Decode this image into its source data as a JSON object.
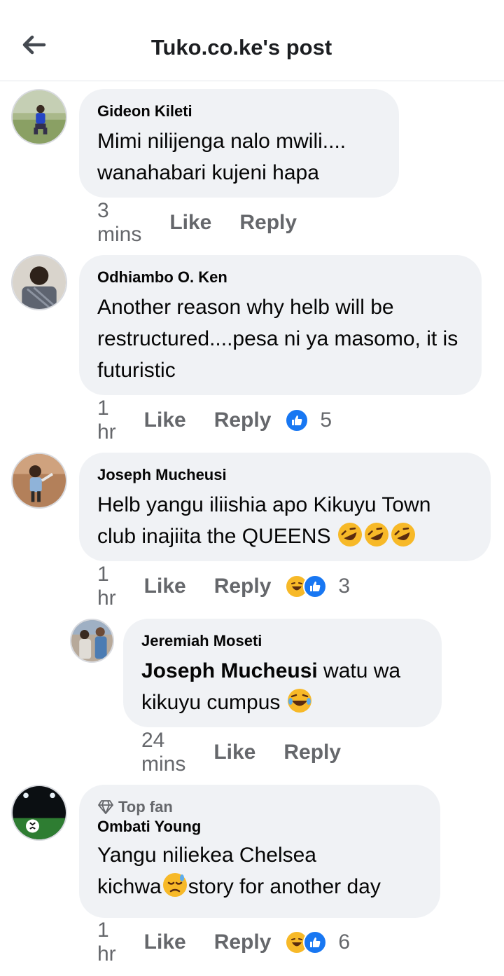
{
  "header": {
    "title": "Tuko.co.ke's post"
  },
  "comments": [
    {
      "author": "Gideon Kileti",
      "text": "Mimi nilijenga nalo mwili.... wanahabari kujeni hapa",
      "time": "3 mins",
      "like": "Like",
      "reply": "Reply"
    },
    {
      "author": "Odhiambo O. Ken",
      "text": "Another reason why helb will be restructured....pesa ni ya masomo, it is futuristic",
      "time": "1 hr",
      "like": "Like",
      "reply": "Reply",
      "reaction_count": "5"
    },
    {
      "author": "Joseph Mucheusi",
      "text_line1": "Helb yangu iliishia apo Kikuyu Town",
      "text_line2": "club inajiita the QUEENS",
      "time": "1 hr",
      "like": "Like",
      "reply": "Reply",
      "reaction_count": "3"
    },
    {
      "author": "Jeremiah Moseti",
      "mention": "Joseph Mucheusi",
      "text_line1": " watu wa",
      "text_line2": "kikuyu cumpus",
      "time": "24 mins",
      "like": "Like",
      "reply": "Reply"
    },
    {
      "badge": "Top fan",
      "author": "Ombati Young",
      "text_line1": "Yangu niliekea Chelsea",
      "text_line2a": "kichwa",
      "text_line2b": "story for another day",
      "time": "1 hr",
      "like": "Like",
      "reply": "Reply",
      "reaction_count": "6"
    }
  ],
  "icons": {
    "back": "arrow-left-icon",
    "like": "thumbs-up-icon",
    "haha": "laughing-emoji-icon",
    "rofl": "rolling-laughing-emoji-icon",
    "joy": "tears-of-joy-emoji-icon",
    "sad": "sad-sweat-emoji-icon",
    "diamond": "diamond-icon"
  },
  "colors": {
    "like_blue": "#1877f2",
    "bubble": "#f0f2f5",
    "secondary_text": "#65676b"
  }
}
